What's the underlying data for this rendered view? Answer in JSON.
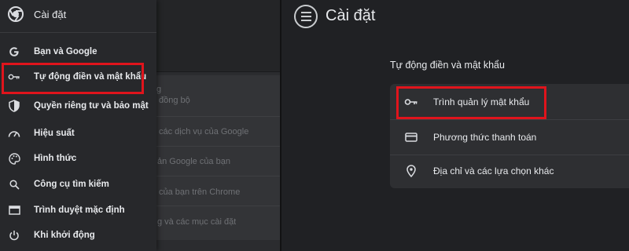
{
  "drawer": {
    "title": "Cài đặt",
    "items": [
      {
        "label": "Bạn và Google",
        "icon": "google-icon"
      },
      {
        "label": "Tự động điền và mật khẩu",
        "icon": "key-icon"
      },
      {
        "label": "Quyền riêng tư và bảo mật",
        "icon": "shield-icon"
      },
      {
        "label": "Hiệu suất",
        "icon": "speedometer-icon"
      },
      {
        "label": "Hình thức",
        "icon": "palette-icon"
      },
      {
        "label": "Công cụ tìm kiếm",
        "icon": "search-icon"
      },
      {
        "label": "Trình duyệt mặc định",
        "icon": "browser-window-icon"
      },
      {
        "label": "Khi khởi động",
        "icon": "power-icon"
      }
    ]
  },
  "background": {
    "rows": [
      "g",
      "đồng bộ",
      "các dịch vụ của Google",
      "ản Google của bạn",
      "của bạn trên Chrome",
      "g và các mục cài đặt"
    ]
  },
  "main": {
    "title": "Cài đặt",
    "section_heading": "Tự động điền và mật khẩu",
    "rows": [
      {
        "label": "Trình quản lý mật khẩu",
        "icon": "key-icon"
      },
      {
        "label": "Phương thức thanh toán",
        "icon": "credit-card-icon"
      },
      {
        "label": "Địa chỉ và các lựa chọn khác",
        "icon": "location-pin-icon"
      }
    ]
  },
  "colors": {
    "highlight": "#e0141c",
    "background": "#202124",
    "text": "#e8eaed"
  }
}
